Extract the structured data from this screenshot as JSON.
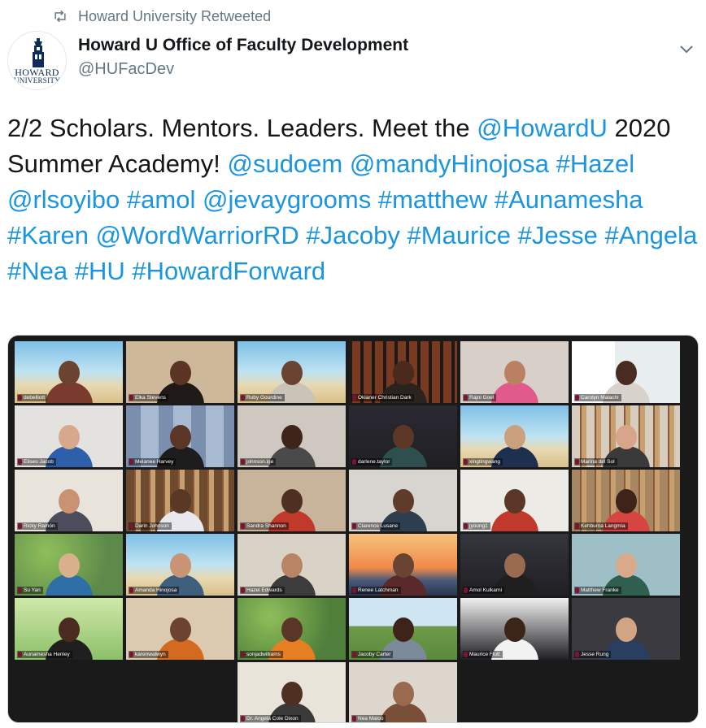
{
  "retweet": {
    "icon": "retweet-icon",
    "text": "Howard University Retweeted"
  },
  "author": {
    "avatar_text_line1": "HOWARD",
    "avatar_text_line2": "UNIVERSITY",
    "name": "Howard U Office of Faculty Development",
    "handle": "@HUFacDev"
  },
  "menu_icon": "chevron-down-icon",
  "tweet": {
    "segments": [
      {
        "text": "2/2 Scholars. Mentors. Leaders. Meet the ",
        "link": false
      },
      {
        "text": "@HowardU",
        "link": true
      },
      {
        "text": " 2020 Summer Academy! ",
        "link": false
      },
      {
        "text": "@sudoem",
        "link": true
      },
      {
        "text": " ",
        "link": false
      },
      {
        "text": "@mandyHinojosa",
        "link": true
      },
      {
        "text": " ",
        "link": false
      },
      {
        "text": "#Hazel",
        "link": true
      },
      {
        "text": " ",
        "link": false
      },
      {
        "text": "@rlsoyibo",
        "link": true
      },
      {
        "text": " ",
        "link": false
      },
      {
        "text": "#amol",
        "link": true
      },
      {
        "text": " ",
        "link": false
      },
      {
        "text": "@jevaygrooms",
        "link": true
      },
      {
        "text": " ",
        "link": false
      },
      {
        "text": "#matthew",
        "link": true
      },
      {
        "text": " ",
        "link": false
      },
      {
        "text": "#Aunamesha",
        "link": true,
        "break_after": true
      },
      {
        "text": "#Karen",
        "link": true
      },
      {
        "text": " ",
        "link": false
      },
      {
        "text": "@WordWarriorRD",
        "link": true
      },
      {
        "text": " ",
        "link": false
      },
      {
        "text": "#Jacoby",
        "link": true
      },
      {
        "text": " ",
        "link": false
      },
      {
        "text": "#Maurice",
        "link": true
      },
      {
        "text": " ",
        "link": false
      },
      {
        "text": "#Jesse",
        "link": true
      },
      {
        "text": " ",
        "link": false
      },
      {
        "text": "#Angela",
        "link": true
      },
      {
        "text": " ",
        "link": false
      },
      {
        "text": "#Nea",
        "link": true
      },
      {
        "text": " ",
        "link": false
      },
      {
        "text": "#HU",
        "link": true
      },
      {
        "text": " ",
        "link": false
      },
      {
        "text": "#HowardForward",
        "link": true
      }
    ]
  },
  "colors": {
    "link": "#1b95e0",
    "text": "#14171a",
    "secondary": "#657786",
    "mic_muted": "#e0245e"
  },
  "video_grid": {
    "participants": [
      {
        "name": "debelliott",
        "scene": "beach",
        "bg": "#8fc7dd",
        "skin": "#6b4330",
        "shirt": "#7a3b2e"
      },
      {
        "name": "Elka Stevens",
        "scene": "room",
        "bg": "#cdb89a",
        "skin": "#5a3526",
        "shirt": "#1f1a17"
      },
      {
        "name": "Ruby Gourdine",
        "scene": "beach",
        "bg": "#9fd2e8",
        "skin": "#6a4332",
        "shirt": "#c9c3b8"
      },
      {
        "name": "Okianer Christian Dark",
        "scene": "gate",
        "bg": "#7a3a22",
        "skin": "#4a2a1c",
        "shirt": "#2a2320"
      },
      {
        "name": "Rajni Goel",
        "scene": "room",
        "bg": "#d8cfc8",
        "skin": "#b98063",
        "shirt": "#e05a8a"
      },
      {
        "name": "Carolyn Malachi",
        "scene": "window",
        "bg": "#e8eef0",
        "skin": "#4a2b1f",
        "shirt": "#d8d2cc"
      },
      {
        "name": "Eliseo Jacob",
        "scene": "wall",
        "bg": "#e4e2df",
        "skin": "#d7a88c",
        "shirt": "#2f5fa8"
      },
      {
        "name": "Melanee Harvey",
        "scene": "columns",
        "bg": "#a8b9d2",
        "skin": "#5b3626",
        "shirt": "#1d1d1d"
      },
      {
        "name": "johnson.ige",
        "scene": "wall",
        "bg": "#cfc8c0",
        "skin": "#3d251a",
        "shirt": "#4a4a4a"
      },
      {
        "name": "darlene.taylor",
        "scene": "dark",
        "bg": "#2b2a33",
        "skin": "#5c3828",
        "shirt": "#2f4f4f"
      },
      {
        "name": "xingtingwang",
        "scene": "beach",
        "bg": "#7fb9d6",
        "skin": "#caa07e",
        "shirt": "#1f2f4f"
      },
      {
        "name": "Marina del Sol",
        "scene": "shelf",
        "bg": "#d6cdbf",
        "skin": "#d9a58a",
        "shirt": "#3a3a3a"
      },
      {
        "name": "Ricky Ramón",
        "scene": "wall",
        "bg": "#e8e4dc",
        "skin": "#c99373",
        "shirt": "#4c4c5c"
      },
      {
        "name": "Darin Johnson",
        "scene": "shelf",
        "bg": "#6e4a2f",
        "skin": "#5a3826",
        "shirt": "#e8e8ee"
      },
      {
        "name": "Sandra Shannon",
        "scene": "room",
        "bg": "#c8b49a",
        "skin": "#4f2f22",
        "shirt": "#c0392b"
      },
      {
        "name": "Clarence Lusane",
        "scene": "wall",
        "bg": "#d8d4cf",
        "skin": "#5e3b2a",
        "shirt": "#2c3e50"
      },
      {
        "name": "jyoung1",
        "scene": "wall",
        "bg": "#ecebe6",
        "skin": "#5a3626",
        "shirt": "#c0392b"
      },
      {
        "name": "Kehbuma Langmia",
        "scene": "shelf",
        "bg": "#a78762",
        "skin": "#3e2418",
        "shirt": "#d64541"
      },
      {
        "name": "Su Yan",
        "scene": "trees",
        "bg": "#5d8a4a",
        "skin": "#d8b08c",
        "shirt": "#2f6fa8"
      },
      {
        "name": "Amanda Hinojosa",
        "scene": "beach",
        "bg": "#bcd6e2",
        "skin": "#c99474",
        "shirt": "#3f5f7f"
      },
      {
        "name": "Hazel Edwards",
        "scene": "room",
        "bg": "#d9d2c7",
        "skin": "#b98466",
        "shirt": "#3c3c3c"
      },
      {
        "name": "Renee Latchman",
        "scene": "sunset",
        "bg": "#f2a86a",
        "skin": "#6a4332",
        "shirt": "#5a2a2a"
      },
      {
        "name": "Amol Kulkarni",
        "scene": "dark",
        "bg": "#35363c",
        "skin": "#9a6b4e",
        "shirt": "#1f1f1f"
      },
      {
        "name": "Matthew Franke",
        "scene": "wall",
        "bg": "#9fbfc7",
        "skin": "#d9a98c",
        "shirt": "#2f5f4f"
      },
      {
        "name": "Aunamesha Henley",
        "scene": "grass",
        "bg": "#8cc06a",
        "skin": "#4a2b1f",
        "shirt": "#1f1f1f"
      },
      {
        "name": "karenwalwyn",
        "scene": "room",
        "bg": "#dccab0",
        "skin": "#6b4330",
        "shirt": "#d46a1f"
      },
      {
        "name": "sonjadwilliams",
        "scene": "trees",
        "bg": "#4f7f3a",
        "skin": "#5a3626",
        "shirt": "#e67e22"
      },
      {
        "name": "Jacoby Carter",
        "scene": "field",
        "bg": "#b8d8e8",
        "skin": "#3e2418",
        "shirt": "#7a8a9a"
      },
      {
        "name": "Maurice Flutt",
        "scene": "dark",
        "bg": "#f0f0f0",
        "skin": "#3b2418",
        "shirt": "#f2f2f2"
      },
      {
        "name": "Jesse Rung",
        "scene": "room",
        "bg": "#3a3a40",
        "skin": "#d2a484",
        "shirt": "#2a3f5f"
      },
      {
        "name": "Dr. Angela Cole Dixon",
        "scene": "room",
        "bg": "#e9e4da",
        "skin": "#4f2f22",
        "shirt": "#3a3a3a"
      },
      {
        "name": "Nea Maloo",
        "scene": "wall",
        "bg": "#dcd6cc",
        "skin": "#9a6a4e",
        "shirt": "#7a4f3a"
      }
    ]
  }
}
